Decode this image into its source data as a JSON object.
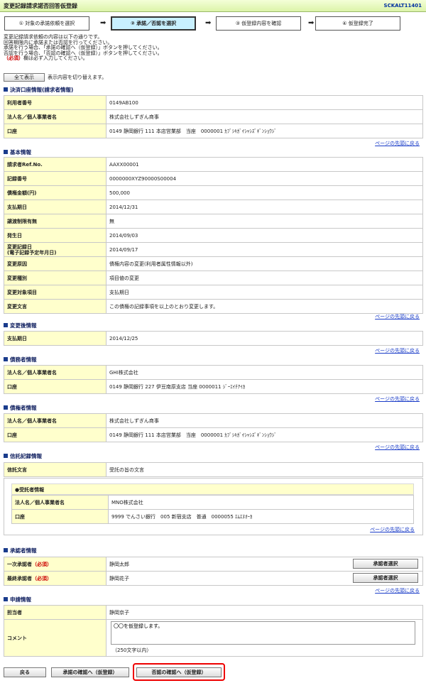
{
  "header": {
    "title": "変更記録請求諾否回答仮登録",
    "screen_id": "SCKALT11401"
  },
  "steps": [
    "① 対象の承諾依頼を選択",
    "② 承諾／否認を選択",
    "③ 仮登録内容を確認",
    "④ 仮登録完了"
  ],
  "description": {
    "line1": "変更記録請求依頼の内容は以下の通りです。",
    "line2": "回答期限内に承諾または否認を行ってください。",
    "line3": "承諾を行う場合、「承諾の確認へ（仮登録）」ボタンを押してください。",
    "line4": "否認を行う場合、「否認の確認へ（仮登録）」ボタンを押してください。",
    "req_mark": "（必須）",
    "req_text": "欄は必ず入力してください。"
  },
  "show_all": {
    "button": "全て表示",
    "note": "表示内容を切り替えます。"
  },
  "top_link": "ページの先頭に戻る",
  "settlement": {
    "heading": "決済口座情報(請求者情報)",
    "rows": [
      {
        "k": "利用者番号",
        "v": "0149AB100"
      },
      {
        "k": "法人名／個人事業者名",
        "v": "株式会社しずぎん商事"
      },
      {
        "k": "口座",
        "v": "0149 静岡銀行 111 本店営業部　当座　0000001 ｶﾌﾞｼｷｶﾞｲｼｬｼｽﾞｷﾞﾝｼｮｳｼﾞ"
      }
    ]
  },
  "basic": {
    "heading": "基本情報",
    "rows": [
      {
        "k": "請求者Ref.No.",
        "v": "AAXX00001"
      },
      {
        "k": "記録番号",
        "v": "0000000XYZ90000S00004"
      },
      {
        "k": "債権金額(円)",
        "v": "500,000"
      },
      {
        "k": "支払期日",
        "v": "2014/12/31"
      },
      {
        "k": "譲渡制限有無",
        "v": "無"
      },
      {
        "k": "発生日",
        "v": "2014/09/03"
      },
      {
        "k": "変更記録日",
        "k2": "(電子記録予定年月日)",
        "v": "2014/09/17"
      },
      {
        "k": "変更原因",
        "v": "債権内容の変更(利用者属性情報以外)"
      },
      {
        "k": "変更種別",
        "v": "項目値の変更"
      },
      {
        "k": "変更対象項目",
        "v": "支払期日"
      },
      {
        "k": "変更文言",
        "v": "この債権の記録事項を以上のとおり変更します。"
      }
    ]
  },
  "after": {
    "heading": "変更後情報",
    "rows": [
      {
        "k": "支払期日",
        "v": "2014/12/25"
      }
    ]
  },
  "debtor": {
    "heading": "債務者情報",
    "rows": [
      {
        "k": "法人名／個人事業者名",
        "v": "GHI株式会社"
      },
      {
        "k": "口座",
        "v": "0149 静岡銀行 227 伊豆南原支店 当座 0000011 ｼﾞｰｴｲﾁｱｲｶ"
      }
    ]
  },
  "creditor": {
    "heading": "債権者情報",
    "rows": [
      {
        "k": "法人名／個人事業者名",
        "v": "株式会社しずぎん商事"
      },
      {
        "k": "口座",
        "v": "0149 静岡銀行 111 本店営業部　当座　0000001 ｶﾌﾞｼｷｶﾞｲｼｬｼｽﾞｷﾞﾝｼｮｳｼﾞ"
      }
    ]
  },
  "trust": {
    "heading": "信託記録情報",
    "text_key": "信託文言",
    "text_val": "受託の旨の文言",
    "sub_title": "●受託者情報",
    "rows": [
      {
        "k": "法人名／個人事業者名",
        "v": "MNO株式会社"
      },
      {
        "k": "口座",
        "v": "9999 でんさい銀行　005 新宿支店　普通　0000055 ｴﾑｴﾇｵｰｶ"
      }
    ]
  },
  "approver": {
    "heading": "承認者情報",
    "first_k": "一次承認者",
    "first_v": "静岡太郎",
    "final_k": "最終承認者",
    "final_v": "静岡花子",
    "req": "（必須）",
    "select_label": "承認者選択"
  },
  "apply": {
    "heading": "申請情報",
    "person_k": "担当者",
    "person_v": "静岡京子",
    "comment_k": "コメント",
    "comment_v": "〇〇を仮登録します。",
    "comment_note": "（250文字以内）"
  },
  "buttons": {
    "back": "戻る",
    "approve": "承諾の確認へ（仮登録）",
    "reject": "否認の確認へ（仮登録）"
  }
}
